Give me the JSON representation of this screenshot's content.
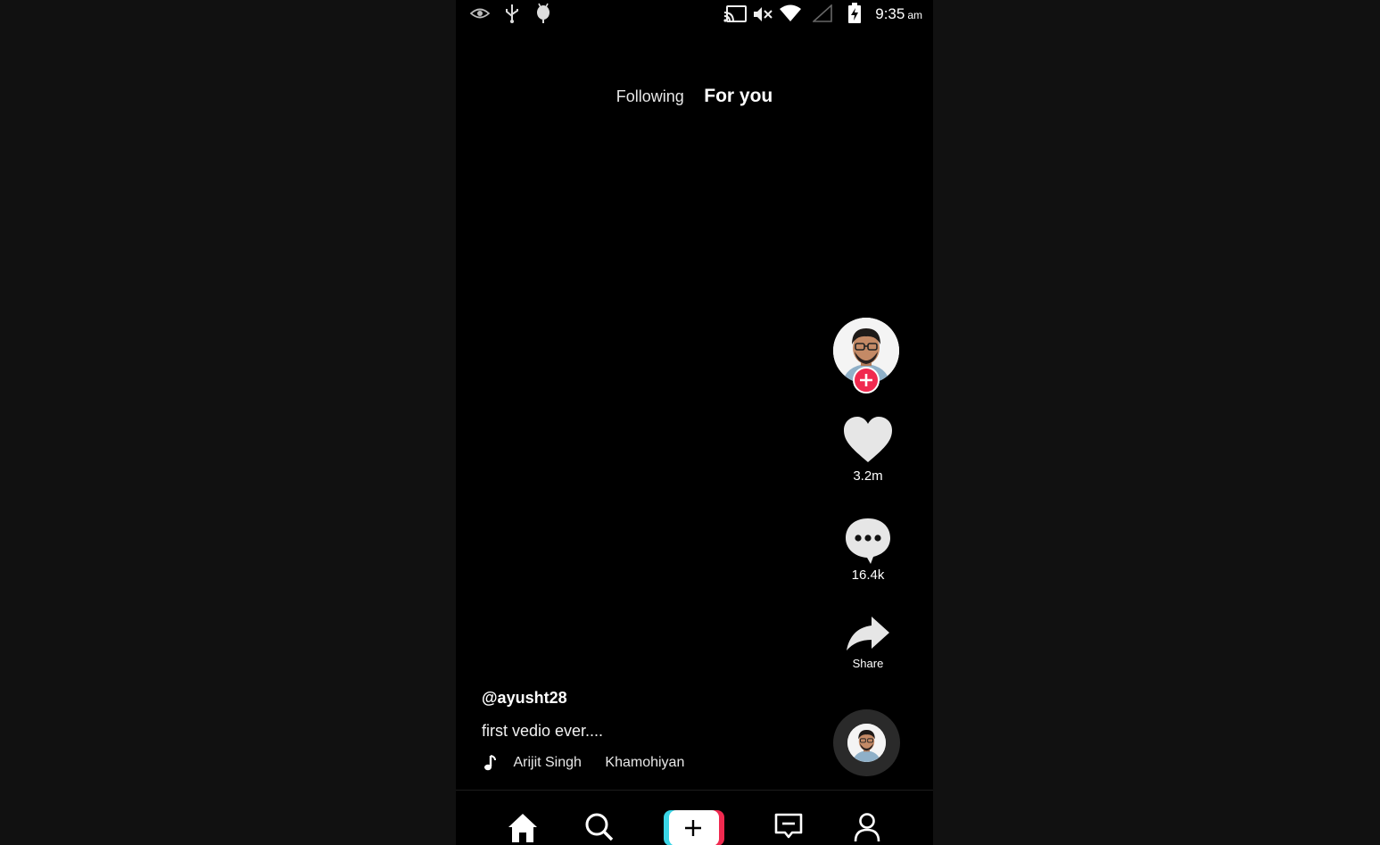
{
  "status_bar": {
    "time": "9:35",
    "ampm": "am",
    "left_icons": [
      "eye-icon",
      "usb-icon",
      "android-debug-icon"
    ],
    "right_icons": [
      "cast-icon",
      "mute-icon",
      "wifi-icon",
      "signal-icon",
      "battery-charging-icon"
    ]
  },
  "tabs": {
    "following": "Following",
    "for_you": "For you",
    "active": "For you"
  },
  "actions": {
    "likes": "3.2m",
    "comments": "16.4k",
    "share": "Share"
  },
  "post": {
    "username": "@ayusht28",
    "caption": "first vedio ever....",
    "song": "Arijit Singh",
    "artist": "Khamohiyan"
  },
  "nav": {
    "items": [
      "home-icon",
      "search-icon",
      "create-button",
      "inbox-icon",
      "profile-icon"
    ]
  },
  "colors": {
    "background": "#000000",
    "accent_pink": "#f0294f",
    "accent_cyan": "#3ad5e6",
    "icon_light": "#e6e6e6"
  }
}
